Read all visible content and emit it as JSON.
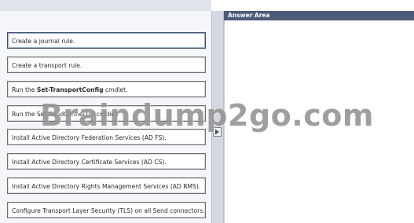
{
  "answer_area": {
    "title": "Answer Area"
  },
  "options": [
    {
      "text": "Create a journal rule."
    },
    {
      "text": "Create a transport rule."
    },
    {
      "prefix": "Run the ",
      "bold": "Set-TransportConfig",
      "suffix": " cmdlet."
    },
    {
      "text": "Run the Set-SendConnector cmdlet."
    },
    {
      "text": "Install Active Directory Federation Services (AD FS)."
    },
    {
      "text": "Install Active Directory Certificate Services (AD CS)."
    },
    {
      "text": "Install Active Directory Rights Management Services (AD RMS)."
    },
    {
      "text": "Configure Transport Layer Security (TLS) on all Send connectors."
    }
  ],
  "watermark": "Braindump2go.com",
  "colors": {
    "header_bg": "#4a5a78",
    "left_pane_bg": "#f4f6f9"
  },
  "icons": {
    "mover": "arrow-right-icon"
  }
}
